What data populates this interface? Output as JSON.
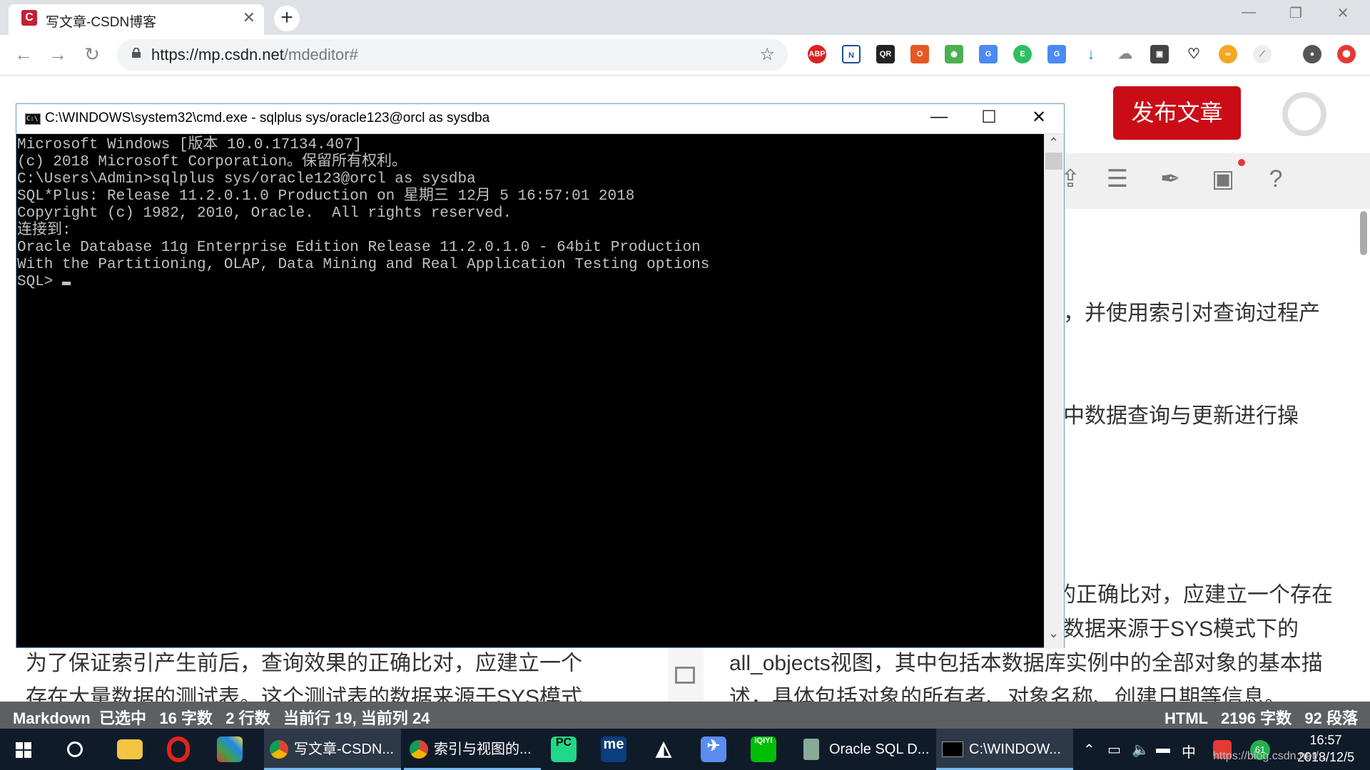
{
  "browser": {
    "tab_title": "写文章-CSDN博客",
    "tab_favicon_letter": "C",
    "tab_close": "✕",
    "newtab_label": "+",
    "window_controls": {
      "minimize": "—",
      "restore": "❐",
      "close": "✕"
    },
    "nav": {
      "back": "←",
      "forward": "→",
      "reload": "↻"
    },
    "url_host": "https://mp.csdn.net",
    "url_path": "/mdeditor#",
    "star": "☆",
    "extensions": [
      "ABP",
      "N",
      "QR",
      "O",
      "◉",
      "G",
      "E",
      "G",
      "↓",
      "☁",
      "▣",
      "♡",
      "∞",
      "⟋"
    ],
    "profile": "●",
    "menu": "⬤"
  },
  "csdn": {
    "publish_label": "发布文章",
    "toolbar_icons": [
      "upload-icon",
      "list-icon",
      "feather-add-icon",
      "save-icon",
      "help-icon"
    ],
    "right_paragraphs": [
      "，并使用索引对查询过程产",
      "中数据查询与更新进行操",
      "的正确比对，应建立一个存在",
      "数据来源于SYS模式下的",
      "all_objects视图，其中包括本数据库实例中的全部对象的基本描",
      "述，具体包括对象的所有者、对象名称、创建日期等信息。"
    ],
    "left_paragraphs": [
      "为了保证索引产生前后，查询效果的正确比对，应建立一个",
      "存在大量数据的测试表。这个测试表的数据来源于SYS模式"
    ],
    "status_left": "Markdown  已选中   16 字数   2 行数   当前行 19, 当前列 24",
    "status_right": "HTML   2196 字数   92 段落"
  },
  "cmd": {
    "title": "C:\\WINDOWS\\system32\\cmd.exe - sqlplus  sys/oracle123@orcl as sysdba",
    "icon_text": "C:\\",
    "controls": {
      "minimize": "—",
      "maximize": "☐",
      "close": "✕"
    },
    "scroll_up": "⌃",
    "scroll_down": "⌄",
    "lines": [
      "Microsoft Windows [版本 10.0.17134.407]",
      "(c) 2018 Microsoft Corporation。保留所有权利。",
      "",
      "C:\\Users\\Admin>sqlplus sys/oracle123@orcl as sysdba",
      "",
      "SQL*Plus: Release 11.2.0.1.0 Production on 星期三 12月 5 16:57:01 2018",
      "",
      "Copyright (c) 1982, 2010, Oracle.  All rights reserved.",
      "",
      "",
      "连接到:",
      "Oracle Database 11g Enterprise Edition Release 11.2.0.1.0 - 64bit Production",
      "With the Partitioning, OLAP, Data Mining and Real Application Testing options",
      ""
    ],
    "prompt": "SQL> "
  },
  "taskbar": {
    "apps": [
      {
        "label": "写文章-CSDN..."
      },
      {
        "label": "索引与视图的..."
      },
      {
        "label": "Oracle SQL D..."
      },
      {
        "label": "C:\\WINDOW..."
      }
    ],
    "icon_labels": {
      "pycharm": "PC",
      "me": "me",
      "iqiyi": "iQIYI"
    },
    "tray_ime": "中",
    "tray_badge": "61",
    "clock_time": "16:57",
    "clock_date": "2018/12/5",
    "watermark": "https://blog.csdn.net/..."
  }
}
